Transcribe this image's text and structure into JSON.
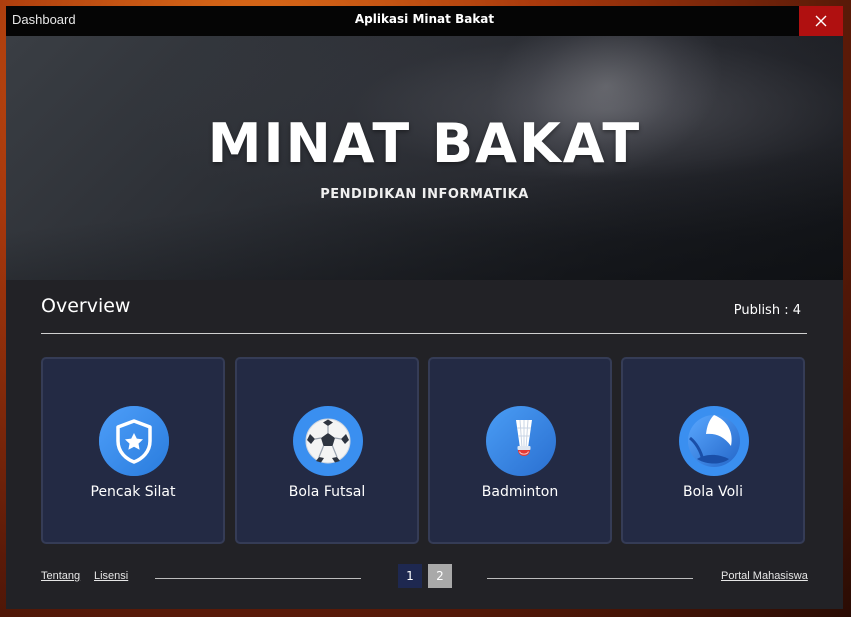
{
  "titlebar": {
    "left_label": "Dashboard",
    "title": "Aplikasi Minat Bakat",
    "close_icon": "close-icon"
  },
  "hero": {
    "title": "MINAT BAKAT",
    "subtitle": "PENDIDIKAN INFORMATIKA"
  },
  "overview": {
    "title": "Overview",
    "publish_label": "Publish : 4"
  },
  "cards": [
    {
      "label": "Pencak Silat",
      "icon": "shield-star-icon"
    },
    {
      "label": "Bola Futsal",
      "icon": "soccer-ball-icon"
    },
    {
      "label": "Badminton",
      "icon": "shuttlecock-icon"
    },
    {
      "label": "Bola Voli",
      "icon": "volleyball-icon"
    }
  ],
  "footer": {
    "link_about": "Tentang",
    "link_license": "Lisensi",
    "pages": [
      "1",
      "2"
    ],
    "active_page": "1",
    "link_portal": "Portal Mahasiswa"
  },
  "colors": {
    "card_bg": "#232a44",
    "icon_blue": "#3a8ff0",
    "close_red": "#b01010",
    "page_active": "#1e2850",
    "page_inactive": "#a9a9a9"
  }
}
